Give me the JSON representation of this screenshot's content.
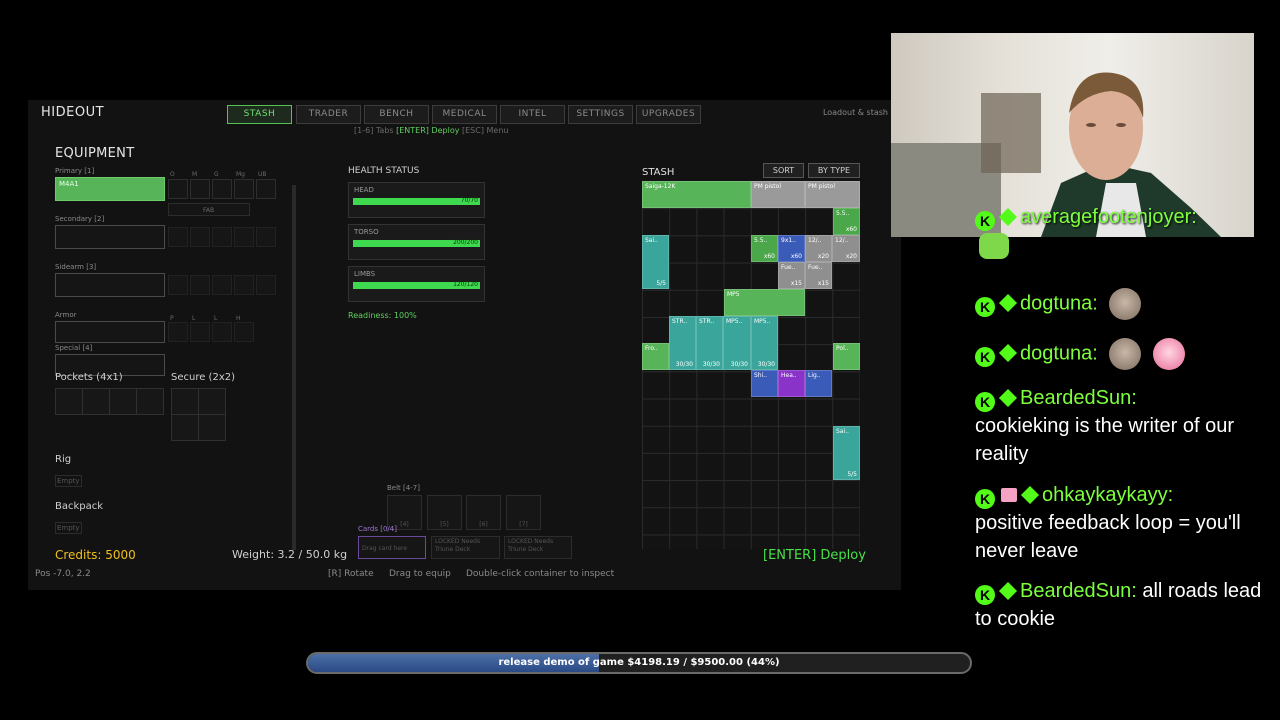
{
  "game": {
    "title": "HIDEOUT",
    "tabs": [
      "STASH",
      "TRADER",
      "BENCH",
      "MEDICAL",
      "INTEL",
      "SETTINGS",
      "UPGRADES"
    ],
    "active_tab": "STASH",
    "header_right": "Loadout & stash",
    "hint_keys": "[1-6] Tabs",
    "hint_deploy": "[ENTER] Deploy",
    "hint_menu": "[ESC] Menu",
    "equipment": {
      "title": "EQUIPMENT",
      "primary_label": "Primary [1]",
      "primary_item": "M4A1",
      "secondary_label": "Secondary [2]",
      "sidearm_label": "Sidearm [3]",
      "armor_label": "Armor",
      "special_label": "Special [4]",
      "pockets_label": "Pockets (4x1)",
      "secure_label": "Secure (2x2)",
      "rig_label": "Rig",
      "rig_value": "Empty",
      "backpack_label": "Backpack",
      "backpack_value": "Empty",
      "attach_labels": [
        "O",
        "M",
        "G",
        "Mg",
        "UB"
      ],
      "primary_sub": "FAB",
      "armor_attach": [
        "P",
        "L",
        "L",
        "H"
      ]
    },
    "health": {
      "title": "HEALTH STATUS",
      "parts": [
        {
          "name": "HEAD",
          "value": "70/70",
          "pct": 1.0
        },
        {
          "name": "TORSO",
          "value": "200/200",
          "pct": 1.0
        },
        {
          "name": "LIMBS",
          "value": "120/120",
          "pct": 1.0
        }
      ],
      "readiness": "Readiness: 100%"
    },
    "stash": {
      "title": "STASH",
      "sort_label": "SORT",
      "bytype_label": "BY TYPE"
    },
    "belt_label": "Belt [4-7]",
    "belt_slots": [
      "[4]",
      "[5]",
      "[6]",
      "[7]"
    ],
    "cards_label": "Cards [0/4]",
    "card_slots": [
      "Drag card here",
      "LOCKED Needs Triune Deck",
      "LOCKED Needs Triune Deck"
    ],
    "credits": "Credits: 5000",
    "weight": "Weight: 3.2 / 50.0 kg",
    "deploy": "[ENTER] Deploy",
    "pos": "Pos -7.0, 2.2",
    "footer_hints": [
      "[R] Rotate",
      "Drag to equip",
      "Double-click container to inspect"
    ]
  },
  "chat": [
    {
      "user": "averagefootenjoyer:",
      "message": "",
      "gift": false
    },
    {
      "user": "dogtuna:",
      "message": "",
      "gift": false
    },
    {
      "user": "dogtuna:",
      "message": "",
      "gift": false
    },
    {
      "user": "BeardedSun:",
      "message": "cookieking is the writer of our reality",
      "gift": false
    },
    {
      "user": "ohkaykaykayy:",
      "message": "positive feedback loop = you'll never leave",
      "gift": true
    },
    {
      "user": "BeardedSun:",
      "message": "all roads lead to cookie",
      "gift": false
    }
  ],
  "donation": {
    "text": "release demo of game $4198.19 / $9500.00 (44%)",
    "progress": 0.44
  },
  "colors": {
    "accent_green": "#5fd05f",
    "item_green": "#58b458",
    "item_gray": "#8f8f8f",
    "item_teal": "#3aa59a",
    "item_blue": "#3b5bb8",
    "item_purple": "#8a33c8",
    "chat_user": "#7dff3e",
    "kick_green": "#53fc18"
  },
  "icons": [
    "kick-badge-icon",
    "diamond-badge-icon",
    "gift-badge-icon"
  ]
}
